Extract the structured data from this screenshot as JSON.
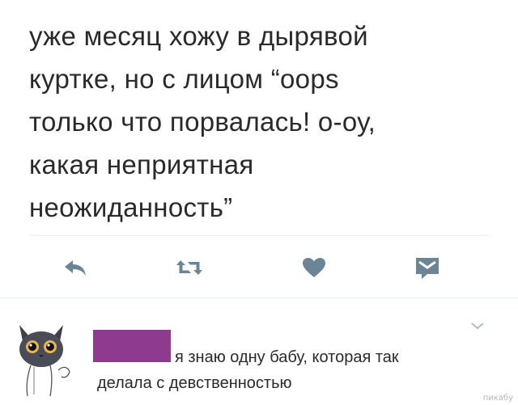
{
  "tweet": {
    "lines": [
      "уже месяц хожу в дырявой",
      "куртке, но с лицом “oops",
      "только что порвалась! о-оу,",
      "какая неприятная",
      "неожиданность”"
    ]
  },
  "actions": {
    "reply_icon": "reply-arrow-icon",
    "retweet_icon": "retweet-icon",
    "like_icon": "heart-icon",
    "message_icon": "envelope-icon"
  },
  "reply": {
    "line1": "я знаю одну бабу, которая так",
    "line2": "делала с девственностью",
    "censor_color": "#8e3a8e"
  },
  "watermark": "пикабу",
  "colors": {
    "icon": "#6b8597",
    "text": "#2a2a2a",
    "divider": "#e6ecf0"
  }
}
